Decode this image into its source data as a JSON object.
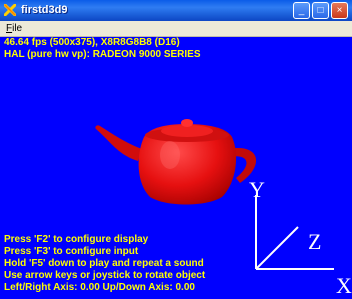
{
  "window": {
    "title": "firstd3d9",
    "minimize_glyph": "_",
    "maximize_glyph": "□",
    "close_glyph": "×"
  },
  "menu": {
    "file_accel": "F",
    "file_rest": "ile"
  },
  "hud_top": [
    "46.64 fps (500x375), X8R8G8B8 (D16)",
    "HAL (pure hw vp): RADEON 9000 SERIES"
  ],
  "hud_bottom": [
    "Press 'F2' to configure display",
    "Press 'F3' to configure input",
    "Hold 'F5' down to play and repeat a sound",
    "Use arrow keys or joystick to rotate object",
    "Left/Right Axis: 0.00 Up/Down Axis: 0.00"
  ],
  "axes": {
    "y": "Y",
    "z": "Z",
    "x": "X"
  },
  "colors": {
    "viewport_bg": "#0000ff",
    "hud_text": "#ffff00",
    "teapot": "#ee1111",
    "axes": "#ffffff"
  }
}
